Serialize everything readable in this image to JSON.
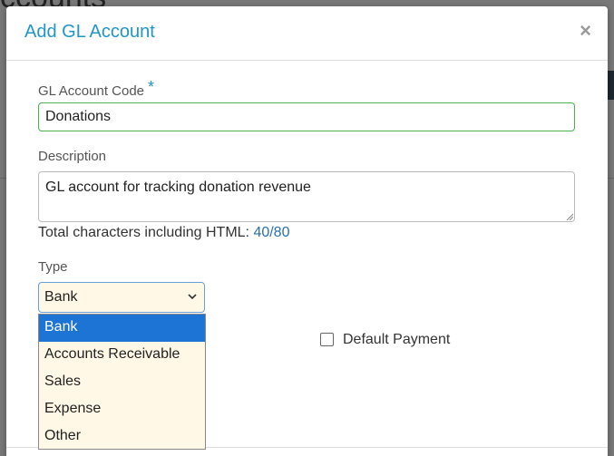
{
  "background": {
    "heading_fragment": "ccounts"
  },
  "modal": {
    "title": "Add GL Account",
    "close_glyph": "×"
  },
  "form": {
    "code": {
      "label": "GL Account Code",
      "required_marker": "*",
      "value": "Donations"
    },
    "description": {
      "label": "Description",
      "value": "GL account for tracking donation revenue"
    },
    "char_count": {
      "prefix": "Total characters including HTML: ",
      "value": "40/80"
    },
    "type": {
      "label": "Type",
      "selected": "Bank",
      "options": [
        "Bank",
        "Accounts Receivable",
        "Sales",
        "Expense",
        "Other"
      ]
    },
    "default_payment": {
      "label": "Default Payment",
      "checked": false
    }
  },
  "colors": {
    "accent": "#2196c9",
    "valid_border": "#4caf50",
    "selected_option": "#1e74d4",
    "select_background": "#fff8e6"
  },
  "icons": {
    "close": "close-icon",
    "chevron": "chevron-down-icon",
    "resize": "resize-grip-icon"
  }
}
